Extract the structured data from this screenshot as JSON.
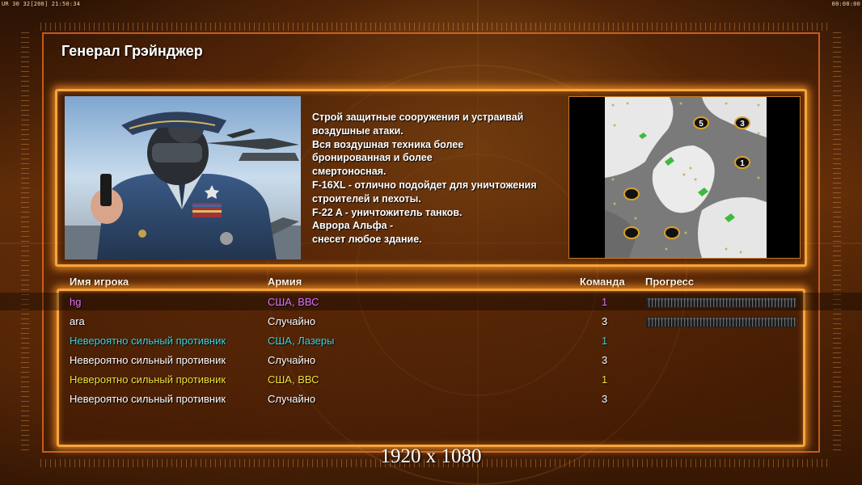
{
  "hud": {
    "left": "UR 30 32[200] 21:50:34",
    "right": "00:00:00"
  },
  "general": {
    "title": "Генерал Грэйнджер",
    "description_lines": [
      "Строй защитные сооружения и устраивай",
      " воздушные атаки.",
      "Вся воздушная техника более",
      " бронированная и более",
      "смертоносная.",
      "F-16XL - отлично подойдет для уничтожения",
      " строителей и пехоты.",
      "F-22 A - уничтожитель танков.",
      "Аврора Альфа -",
      "снесет любое здание."
    ]
  },
  "map": {
    "player_start_labels": [
      "5",
      "3",
      "1"
    ]
  },
  "table": {
    "headers": {
      "name": "Имя игрока",
      "army": "Армия",
      "team": "Команда",
      "progress": "Прогресс"
    },
    "rows": [
      {
        "name": "hg",
        "army": "США, ВВС",
        "team": "1",
        "color": "#e070ff",
        "progress": 0.0,
        "show_progress": true
      },
      {
        "name": "ara",
        "army": "Случайно",
        "team": "3",
        "color": "#ffffff",
        "progress": 0.0,
        "show_progress": true
      },
      {
        "name": "Невероятно сильный противник",
        "army": "США, Лазеры",
        "team": "1",
        "color": "#36d6e0",
        "show_progress": false
      },
      {
        "name": "Невероятно сильный противник",
        "army": "Случайно",
        "team": "3",
        "color": "#ffffff",
        "show_progress": false
      },
      {
        "name": "Невероятно сильный противник",
        "army": "США, ВВС",
        "team": "1",
        "color": "#f2e13a",
        "show_progress": false
      },
      {
        "name": "Невероятно сильный противник",
        "army": "Случайно",
        "team": "3",
        "color": "#ffffff",
        "show_progress": false
      }
    ]
  },
  "caption": "1920 x 1080",
  "colors": {
    "accent_border": "#f6a53a",
    "frame_border": "#ff7828"
  }
}
